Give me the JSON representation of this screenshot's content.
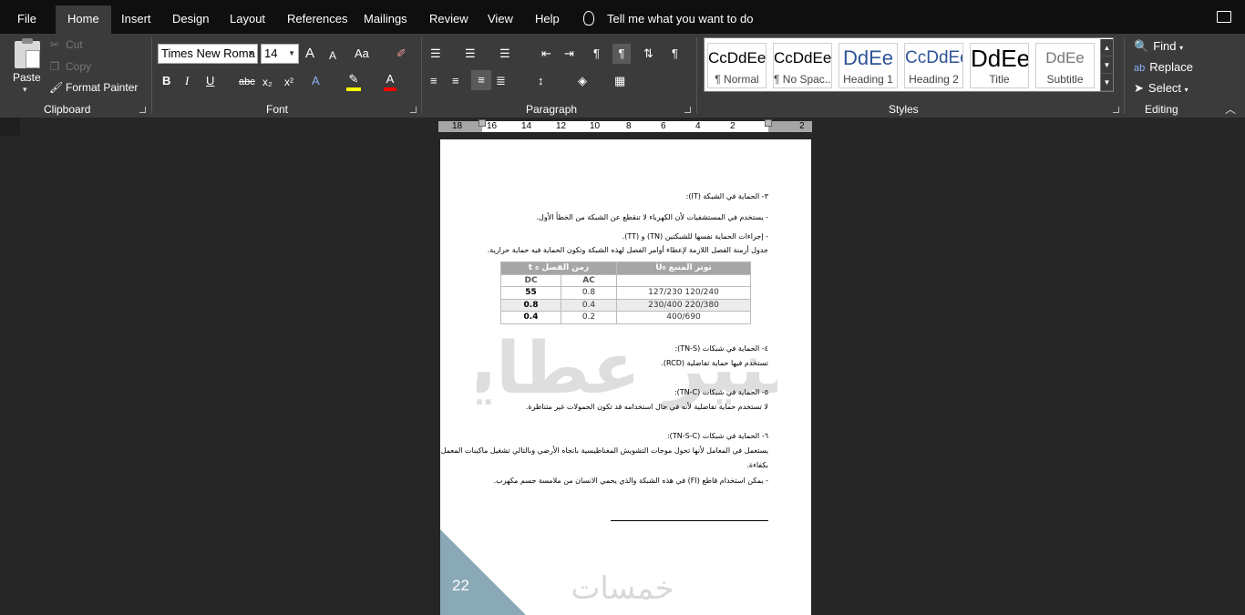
{
  "menubar": {
    "tabs": [
      "File",
      "Home",
      "Insert",
      "Design",
      "Layout",
      "References",
      "Mailings",
      "Review",
      "View",
      "Help"
    ],
    "tell_me": "Tell me what you want to do"
  },
  "clipboard": {
    "paste": "Paste",
    "cut": "Cut",
    "copy": "Copy",
    "format_painter": "Format Painter",
    "group": "Clipboard"
  },
  "font": {
    "name": "Times New Roma",
    "size": "14",
    "group": "Font",
    "bold": "B",
    "italic": "I",
    "underline": "U",
    "strike": "abc",
    "subscript": "x₂",
    "superscript": "x²",
    "grow": "A",
    "shrink": "A",
    "case": "Aa",
    "highlight_color": "#ffff00",
    "font_color": "#ff0000"
  },
  "paragraph": {
    "group": "Paragraph"
  },
  "styles": {
    "group": "Styles",
    "items": [
      {
        "sample": "CcDdEe",
        "name": "¶ Normal"
      },
      {
        "sample": "CcDdEe",
        "name": "¶ No Spac..."
      },
      {
        "sample": "DdEe",
        "name": "Heading 1"
      },
      {
        "sample": "CcDdEe",
        "name": "Heading 2"
      },
      {
        "sample": "DdEe",
        "name": "Title"
      },
      {
        "sample": "DdEe",
        "name": "Subtitle"
      }
    ]
  },
  "editing": {
    "group": "Editing",
    "find": "Find",
    "replace": "Replace",
    "select": "Select"
  },
  "ruler": {
    "ticks": [
      "18",
      "16",
      "14",
      "12",
      "10",
      "8",
      "6",
      "4",
      "2",
      "2"
    ]
  },
  "document": {
    "lines": [
      "٣- الحماية في الشبكة (IT):",
      "- يستخدم في المستشفيات لأن الكهرباء لا تنقطع عن الشبكة من الخطأ الأول.",
      "- إجراءات الحماية نفسها للشبكتين (TN) و (TT).",
      "جدول أزمنة الفصل اللازمة لإعطاء أوامر الفصل لهذه الشبكة وتكون الحماية فيه حماية حرارية.",
      "٤- الحماية في شبكات (TN-S):",
      "تستخدم فيها حماية تفاضلية (RCD).",
      "٥- الحماية في شبكات (TN-C):",
      "لا تستخدم حماية تفاضلية لأنه في حال استخدامه قد تكون الحمولات غير متناظرة.",
      "٦- الحماية في شبكات (TN-S-C):",
      "يستعمل في المعامل لأنها تحول موجات التشويش المغناطيسية باتجاه الأرضي وبالتالي تشغيل ماكينات المعمل",
      "بكفاءة.",
      "- يمكن استخدام قاطع (FI) في هذه الشبكة والذي يحمي الانسان من ملامسة جسم مكهرب."
    ],
    "table": {
      "head": [
        "t ₀  زمن الفصل",
        "U₀  توتر المنبع"
      ],
      "sub": [
        "DC",
        "AC"
      ],
      "rows": [
        [
          "55",
          "0.8",
          "127/230   120/240"
        ],
        [
          "0.8",
          "0.4",
          "230/400   220/380"
        ],
        [
          "0.4",
          "0.2",
          "400/690"
        ]
      ]
    },
    "page_number": "22",
    "watermark": "منير عطايا",
    "logo": "خمسات"
  }
}
